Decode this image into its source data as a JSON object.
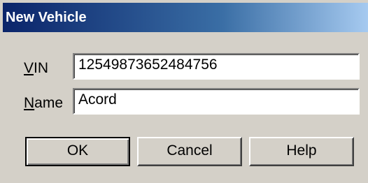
{
  "window": {
    "title": "New Vehicle"
  },
  "form": {
    "vin": {
      "label_mnemonic": "V",
      "label_rest": "IN",
      "value": "12549873652484756"
    },
    "name": {
      "label_mnemonic": "N",
      "label_rest": "ame",
      "value": "Acord"
    }
  },
  "buttons": {
    "ok_label": "OK",
    "cancel_label": "Cancel",
    "help_label": "Help"
  },
  "colors": {
    "dialog_face": "#d4d0c8",
    "titlebar_start": "#0a246a",
    "titlebar_end": "#a6caf0"
  }
}
